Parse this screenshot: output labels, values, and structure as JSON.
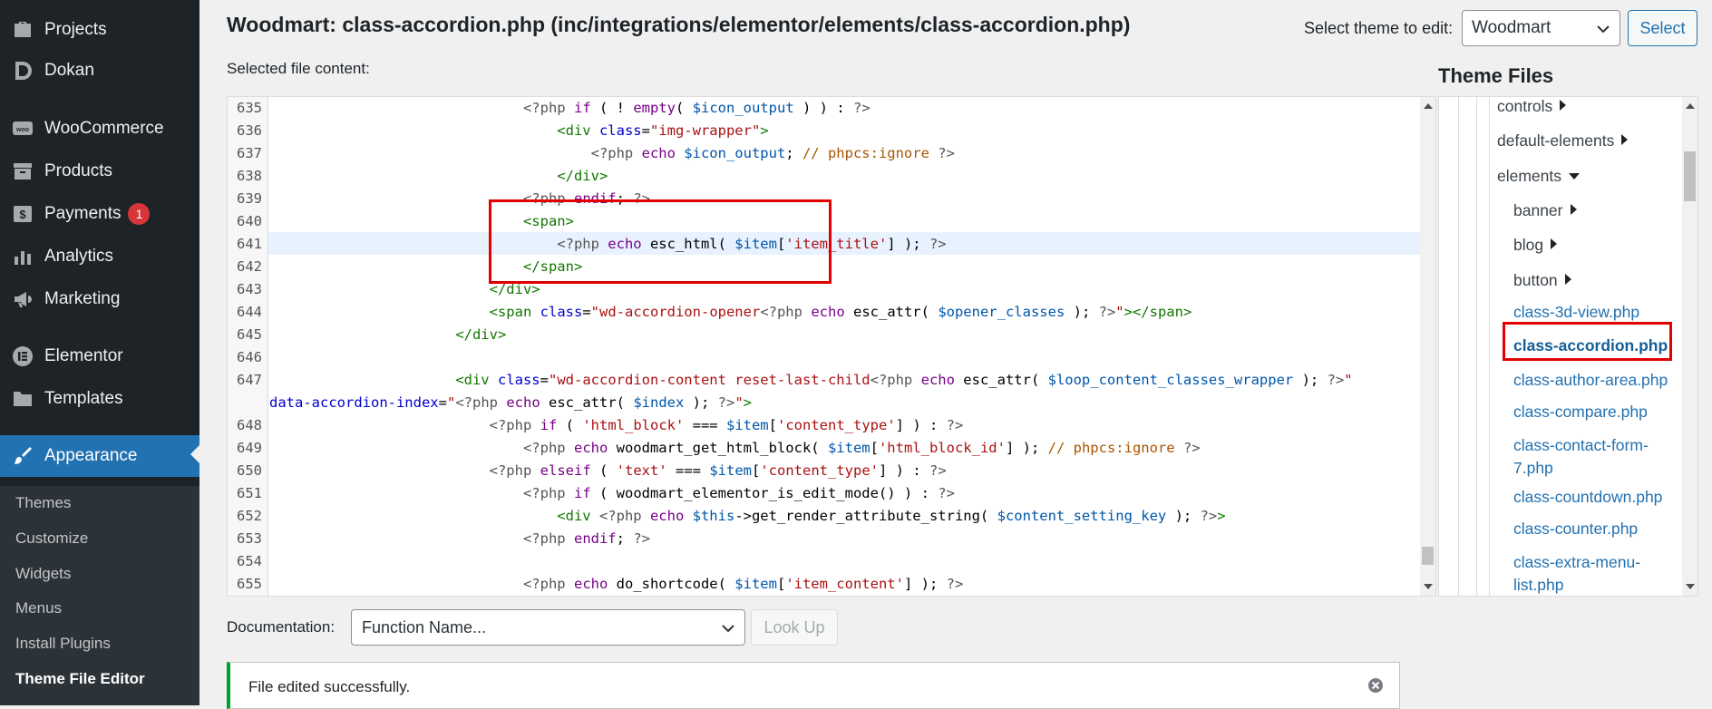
{
  "sidebar": {
    "items": [
      {
        "label": "Projects",
        "icon": "briefcase-icon"
      },
      {
        "label": "Dokan",
        "icon": "dokan-icon"
      },
      {
        "label": "WooCommerce",
        "icon": "woo-icon"
      },
      {
        "label": "Products",
        "icon": "archive-icon"
      },
      {
        "label": "Payments",
        "icon": "dollar-icon",
        "badge": "1"
      },
      {
        "label": "Analytics",
        "icon": "bar-chart-icon"
      },
      {
        "label": "Marketing",
        "icon": "megaphone-icon"
      },
      {
        "label": "Elementor",
        "icon": "elementor-icon"
      },
      {
        "label": "Templates",
        "icon": "folder-icon"
      },
      {
        "label": "Appearance",
        "icon": "paintbrush-icon"
      }
    ],
    "submenu": [
      "Themes",
      "Customize",
      "Widgets",
      "Menus",
      "Install Plugins",
      "Theme File Editor"
    ]
  },
  "header": {
    "title": "Woodmart: class-accordion.php (inc/integrations/elementor/elements/class-accordion.php)",
    "theme_select_label": "Select theme to edit:",
    "theme_selected": "Woodmart",
    "select_button": "Select",
    "selected_file_label": "Selected file content:"
  },
  "editor": {
    "line_numbers": [
      "635",
      "636",
      "637",
      "638",
      "639",
      "640",
      "641",
      "642",
      "643",
      "644",
      "645",
      "646",
      "647",
      "",
      "648",
      "649",
      "650",
      "651",
      "652",
      "653",
      "654",
      "655"
    ]
  },
  "theme_files": {
    "title": "Theme Files",
    "items": [
      {
        "label": "controls",
        "type": "folder-closed"
      },
      {
        "label": "default-elements",
        "type": "folder-closed"
      },
      {
        "label": "elements",
        "type": "folder-open"
      },
      {
        "label": "banner",
        "type": "folder-closed"
      },
      {
        "label": "blog",
        "type": "folder-closed"
      },
      {
        "label": "button",
        "type": "folder-closed"
      },
      {
        "label": "class-3d-view.php",
        "type": "file"
      },
      {
        "label": "class-accordion.php",
        "type": "file-current"
      },
      {
        "label": "class-author-area.php",
        "type": "file"
      },
      {
        "label": "class-compare.php",
        "type": "file"
      },
      {
        "label": "class-contact-form-7.php",
        "type": "file"
      },
      {
        "label": "class-countdown.php",
        "type": "file"
      },
      {
        "label": "class-counter.php",
        "type": "file"
      },
      {
        "label": "class-extra-menu-list.php",
        "type": "file"
      }
    ]
  },
  "documentation": {
    "label": "Documentation:",
    "select_value": "Function Name...",
    "lookup_button": "Look Up"
  },
  "notice": {
    "text": "File edited successfully."
  },
  "colors": {
    "sidebar_bg": "#1d2327",
    "accent": "#2271b1",
    "highlight_box": "#e10000",
    "success": "#00a32a"
  }
}
